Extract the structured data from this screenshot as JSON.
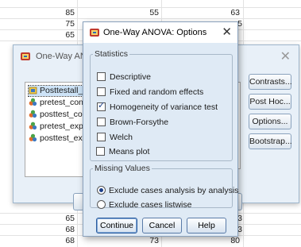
{
  "spreadsheet": {
    "top_rows": [
      {
        "c1": "85",
        "c2": "55",
        "c3": "63"
      },
      {
        "c1": "75",
        "c2": "",
        "c3": "5"
      },
      {
        "c1": "65",
        "c2": "",
        "c3": ""
      }
    ],
    "bottom_rows": [
      {
        "c1": "65",
        "c2": "",
        "c3": "3"
      },
      {
        "c1": "68",
        "c2": "",
        "c3": "3"
      },
      {
        "c1": "68",
        "c2": "73",
        "c3": "80"
      }
    ]
  },
  "anova_dialog": {
    "title": "One-Way ANC",
    "variables": [
      {
        "label": "Posttestall_",
        "icon": "scale-variable-icon",
        "selected": true
      },
      {
        "label": "pretest_con",
        "icon": "nominal-variable-icon"
      },
      {
        "label": "posttest_co",
        "icon": "nominal-variable-icon"
      },
      {
        "label": "pretest_exp",
        "icon": "nominal-variable-icon"
      },
      {
        "label": "posttest_ex",
        "icon": "nominal-variable-icon"
      }
    ],
    "side_buttons": {
      "contrasts": "Contrasts...",
      "post_hoc": "Post Hoc...",
      "options": "Options...",
      "bootstrap": "Bootstrap..."
    }
  },
  "options_dialog": {
    "title": "One-Way ANOVA: Options",
    "statistics": {
      "legend": "Statistics",
      "descriptive": {
        "label": "Descriptive",
        "checked": false
      },
      "fixed_random": {
        "label": "Fixed and random effects",
        "checked": false
      },
      "homogeneity": {
        "label": "Homogeneity of variance test",
        "checked": true
      },
      "brown_forsythe": {
        "label": "Brown-Forsythe",
        "checked": false
      },
      "welch": {
        "label": "Welch",
        "checked": false
      }
    },
    "means_plot": {
      "label": "Means plot",
      "checked": false
    },
    "missing_values": {
      "legend": "Missing Values",
      "analysis_by_analysis": {
        "label": "Exclude cases analysis by analysis",
        "selected": true
      },
      "listwise": {
        "label": "Exclude cases listwise",
        "selected": false
      }
    },
    "buttons": {
      "continue": "Continue",
      "cancel": "Cancel",
      "help": "Help"
    }
  },
  "colors": {
    "dialog_bg": "#dfeaf5",
    "accent": "#1b3f8a"
  }
}
